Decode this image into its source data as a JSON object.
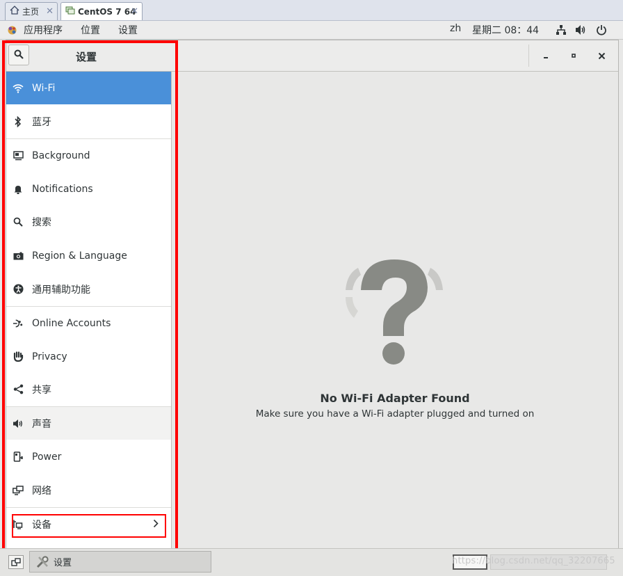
{
  "tabs": [
    {
      "label": "主页",
      "icon": "home-icon"
    },
    {
      "label": "CentOS 7 64",
      "icon": "vm-icon"
    }
  ],
  "topbar": {
    "menus": [
      "应用程序",
      "位置",
      "设置"
    ],
    "input_method": "zh",
    "clock": "星期二 08：44",
    "tray_icons": [
      "network-icon",
      "volume-icon",
      "power-icon"
    ]
  },
  "window": {
    "title": "设置",
    "controls": [
      "minimize",
      "maximize",
      "close"
    ]
  },
  "sidebar": {
    "items": [
      {
        "label": "Wi-Fi",
        "icon": "wifi-icon",
        "selected": true
      },
      {
        "label": "蓝牙",
        "icon": "bluetooth-icon"
      },
      {
        "label": "Background",
        "icon": "background-icon"
      },
      {
        "label": "Notifications",
        "icon": "bell-icon"
      },
      {
        "label": "搜索",
        "icon": "search-icon"
      },
      {
        "label": "Region & Language",
        "icon": "camera-icon"
      },
      {
        "label": "通用辅助功能",
        "icon": "accessibility-icon"
      },
      {
        "label": "Online Accounts",
        "icon": "online-accounts-icon"
      },
      {
        "label": "Privacy",
        "icon": "hand-icon"
      },
      {
        "label": "共享",
        "icon": "share-icon"
      },
      {
        "label": "声音",
        "icon": "speaker-icon"
      },
      {
        "label": "Power",
        "icon": "power-plug-icon"
      },
      {
        "label": "网络",
        "icon": "network-icon"
      },
      {
        "label": "设备",
        "icon": "devices-icon",
        "has_submenu": true
      }
    ]
  },
  "content": {
    "title": "No Wi-Fi Adapter Found",
    "subtitle": "Make sure you have a Wi-Fi adapter plugged and turned on",
    "icon": "question-mark-icon"
  },
  "taskbar": {
    "window_button_label": "设置",
    "watermark": "https://blog.csdn.net/qq_32207665"
  },
  "colors": {
    "accent": "#4a90d9",
    "annotation": "#ff0000",
    "background": "#e8e8e7"
  }
}
